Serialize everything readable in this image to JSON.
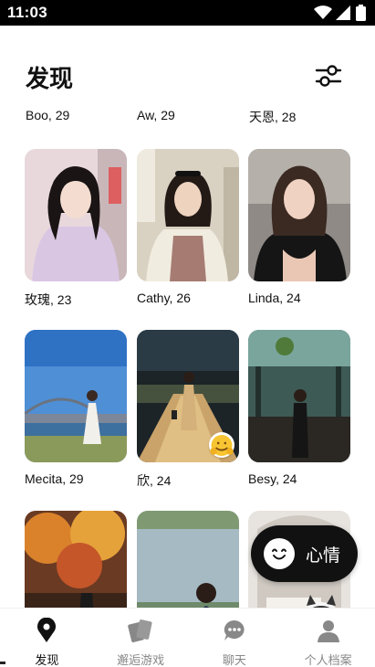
{
  "status_bar": {
    "time": "11:03"
  },
  "header": {
    "title": "发现",
    "filter_icon": "sliders-icon"
  },
  "top_row_names": [
    "Boo, 29",
    "Aw, 29",
    "天恩, 28"
  ],
  "profiles": [
    {
      "name": "玫瑰, 23",
      "scene": "indoor-pink",
      "badge": false
    },
    {
      "name": "Cathy, 26",
      "scene": "indoor-cream",
      "badge": false
    },
    {
      "name": "Linda, 24",
      "scene": "selfie-dark",
      "badge": false
    },
    {
      "name": "Mecita, 29",
      "scene": "harbour-bridge",
      "badge": false
    },
    {
      "name": "欣, 24",
      "scene": "night-bridge",
      "badge": true,
      "badge_icon": "hug-emoji-icon"
    },
    {
      "name": "Besy, 24",
      "scene": "restaurant",
      "badge": false
    },
    {
      "name": "",
      "scene": "autumn",
      "badge": false
    },
    {
      "name": "",
      "scene": "lake",
      "badge": false
    },
    {
      "name": "",
      "scene": "cat",
      "badge": false
    }
  ],
  "mood_button": {
    "label": "心情",
    "icon": "smile-face-icon"
  },
  "bottom_nav": [
    {
      "label": "发现",
      "icon": "location-pin-icon",
      "active": true
    },
    {
      "label": "邂逅游戏",
      "icon": "cards-icon",
      "active": false
    },
    {
      "label": "聊天",
      "icon": "chat-bubble-icon",
      "active": false
    },
    {
      "label": "个人档案",
      "icon": "person-icon",
      "active": false
    }
  ],
  "colors": {
    "accent": "#111111",
    "inactive": "#888888",
    "background": "#ffffff"
  }
}
